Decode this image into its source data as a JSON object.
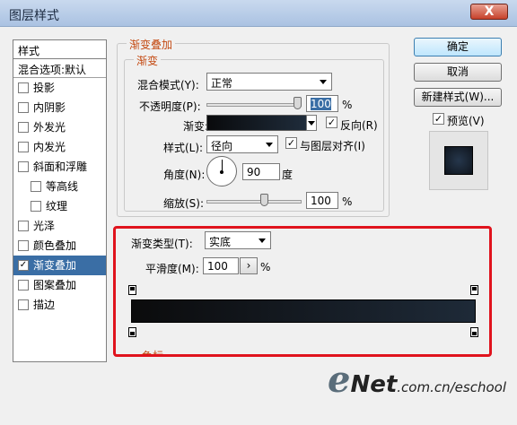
{
  "window": {
    "title": "图层样式",
    "close_label": "X"
  },
  "styles": {
    "header": "样式",
    "blend": "混合选项:默认",
    "items": [
      {
        "label": "投影",
        "checked": false
      },
      {
        "label": "内阴影",
        "checked": false
      },
      {
        "label": "外发光",
        "checked": false
      },
      {
        "label": "内发光",
        "checked": false
      },
      {
        "label": "斜面和浮雕",
        "checked": false
      },
      {
        "label": "等高线",
        "checked": false
      },
      {
        "label": "纹理",
        "checked": false
      },
      {
        "label": "光泽",
        "checked": false
      },
      {
        "label": "颜色叠加",
        "checked": false
      },
      {
        "label": "渐变叠加",
        "checked": true,
        "selected": true
      },
      {
        "label": "图案叠加",
        "checked": false
      },
      {
        "label": "描边",
        "checked": false
      }
    ]
  },
  "gradient_overlay": {
    "section_title": "渐变叠加",
    "subsection_title": "渐变",
    "blend_mode_label": "混合模式(Y):",
    "blend_mode_value": "正常",
    "opacity_label": "不透明度(P):",
    "opacity_value": "100",
    "percent": "%",
    "gradient_label": "渐变:",
    "reverse_label": "反向(R)",
    "reverse_checked": true,
    "style_label": "样式(L):",
    "style_value": "径向",
    "align_label": "与图层对齐(I)",
    "align_checked": true,
    "angle_label": "角度(N):",
    "angle_value": "90",
    "degree": "度",
    "scale_label": "缩放(S):",
    "scale_value": "100"
  },
  "gradient_editor": {
    "type_label": "渐变类型(T):",
    "type_value": "实底",
    "smoothness_label": "平滑度(M):",
    "smoothness_value": "100",
    "smoothness_step": "›",
    "percent": "%",
    "partial_label": "色标"
  },
  "buttons": {
    "ok": "确定",
    "cancel": "取消",
    "new_style": "新建样式(W)...",
    "preview": "预览(V)",
    "preview_checked": true
  },
  "watermark": {
    "e": "e",
    "net": "Net",
    "rest": ".com.cn/eschool"
  },
  "colors": {
    "highlight": "#e0131d",
    "section_title": "#c44a12",
    "selection": "#3a6ea5"
  }
}
